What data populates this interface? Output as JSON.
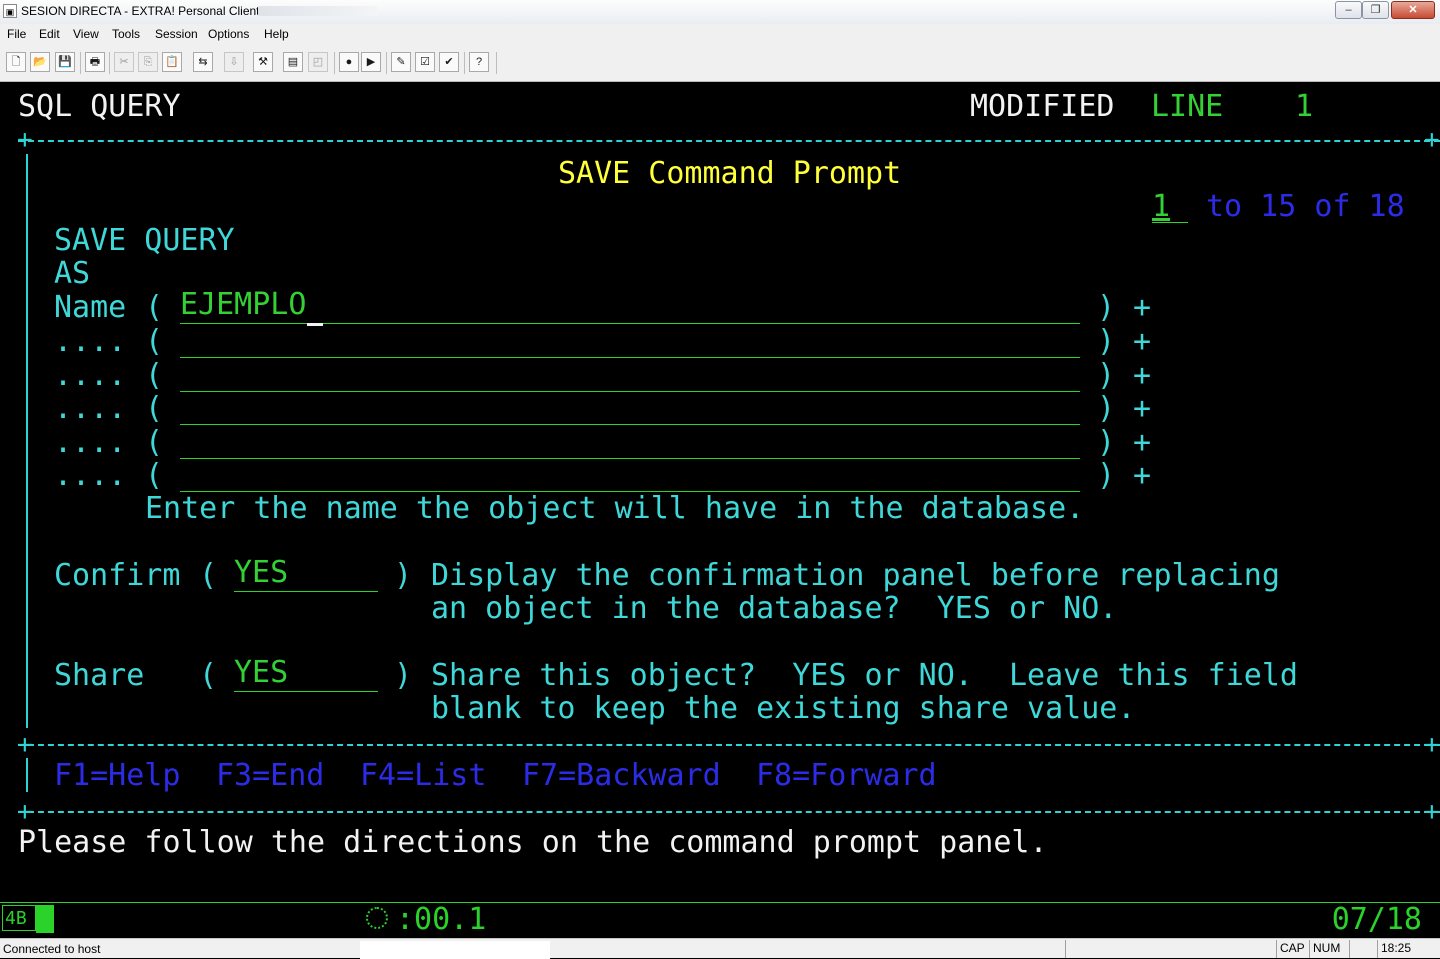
{
  "window": {
    "title": "SESION DIRECTA - EXTRA! Personal Client",
    "controls": {
      "minimize": "–",
      "maximize": "❐",
      "close": "✕"
    }
  },
  "menu": [
    {
      "label": "File"
    },
    {
      "label": "Edit"
    },
    {
      "label": "View"
    },
    {
      "label": "Tools"
    },
    {
      "label": "Session"
    },
    {
      "label": "Options"
    },
    {
      "label": "Help"
    }
  ],
  "toolbar": [
    {
      "icon": "new-icon",
      "glyph": "🗋",
      "enabled": true
    },
    {
      "icon": "open-icon",
      "glyph": "📂",
      "enabled": true
    },
    {
      "icon": "save-icon",
      "glyph": "💾",
      "enabled": true
    },
    {
      "icon": "print-icon",
      "glyph": "🖶",
      "enabled": true
    },
    {
      "icon": "cut-icon",
      "glyph": "✂",
      "enabled": false
    },
    {
      "icon": "copy-icon",
      "glyph": "⎘",
      "enabled": false
    },
    {
      "icon": "paste-icon",
      "glyph": "📋",
      "enabled": true
    },
    {
      "icon": "send-icon",
      "glyph": "⇆",
      "enabled": true
    },
    {
      "icon": "receive-icon",
      "glyph": "⇩",
      "enabled": false
    },
    {
      "icon": "tools-icon",
      "glyph": "⚒",
      "enabled": true
    },
    {
      "icon": "file-transfer-icon",
      "glyph": "▤",
      "enabled": true
    },
    {
      "icon": "macro-icon",
      "glyph": "◰",
      "enabled": false
    },
    {
      "icon": "record-icon",
      "glyph": "●",
      "enabled": true
    },
    {
      "icon": "play-icon",
      "glyph": "▶",
      "enabled": true
    },
    {
      "icon": "edit-icon",
      "glyph": "✎",
      "enabled": true
    },
    {
      "icon": "settings-icon",
      "glyph": "☑",
      "enabled": true
    },
    {
      "icon": "check-icon",
      "glyph": "✔",
      "enabled": true
    },
    {
      "icon": "help-icon",
      "glyph": "?",
      "enabled": true
    }
  ],
  "terminal": {
    "header": {
      "left": "SQL QUERY",
      "status": "MODIFIED",
      "line_label": "LINE",
      "line_value": "1"
    },
    "panel_title": "SAVE Command Prompt",
    "range": {
      "current": "1",
      "rest": "to 15 of 18"
    },
    "command": "SAVE QUERY",
    "as_label": "AS",
    "name_label": "Name",
    "name_value": "EJEMPLO",
    "continuation_label": "....",
    "name_help": "Enter the name the object will have in the database.",
    "confirm": {
      "label": "Confirm",
      "value": "YES",
      "help_line1": "Display the confirmation panel before replacing",
      "help_line2": "an object in the database?  YES or NO."
    },
    "share": {
      "label": "Share",
      "value": "YES",
      "help_line1": "Share this object?  YES or NO.  Leave this field",
      "help_line2": "blank to keep the existing share value."
    },
    "fkeys": [
      "F1=Help",
      "F3=End",
      "F4=List",
      "F7=Backward",
      "F8=Forward"
    ],
    "message": "Please follow the directions on the command prompt panel."
  },
  "oia": {
    "session": "4B",
    "response_time": ":00.1",
    "cursor_position": "07/18"
  },
  "statusbar": {
    "text": "Connected to host",
    "caps": "CAP",
    "num": "NUM",
    "time": "18:25"
  },
  "colors": {
    "terminal_bg": "#000000",
    "field_green": "#34d134",
    "prompt_cyan": "#3fd7d7",
    "title_yellow": "#ffff3a",
    "fkey_blue": "#2c2ce8",
    "text_white": "#f2f2f2"
  }
}
